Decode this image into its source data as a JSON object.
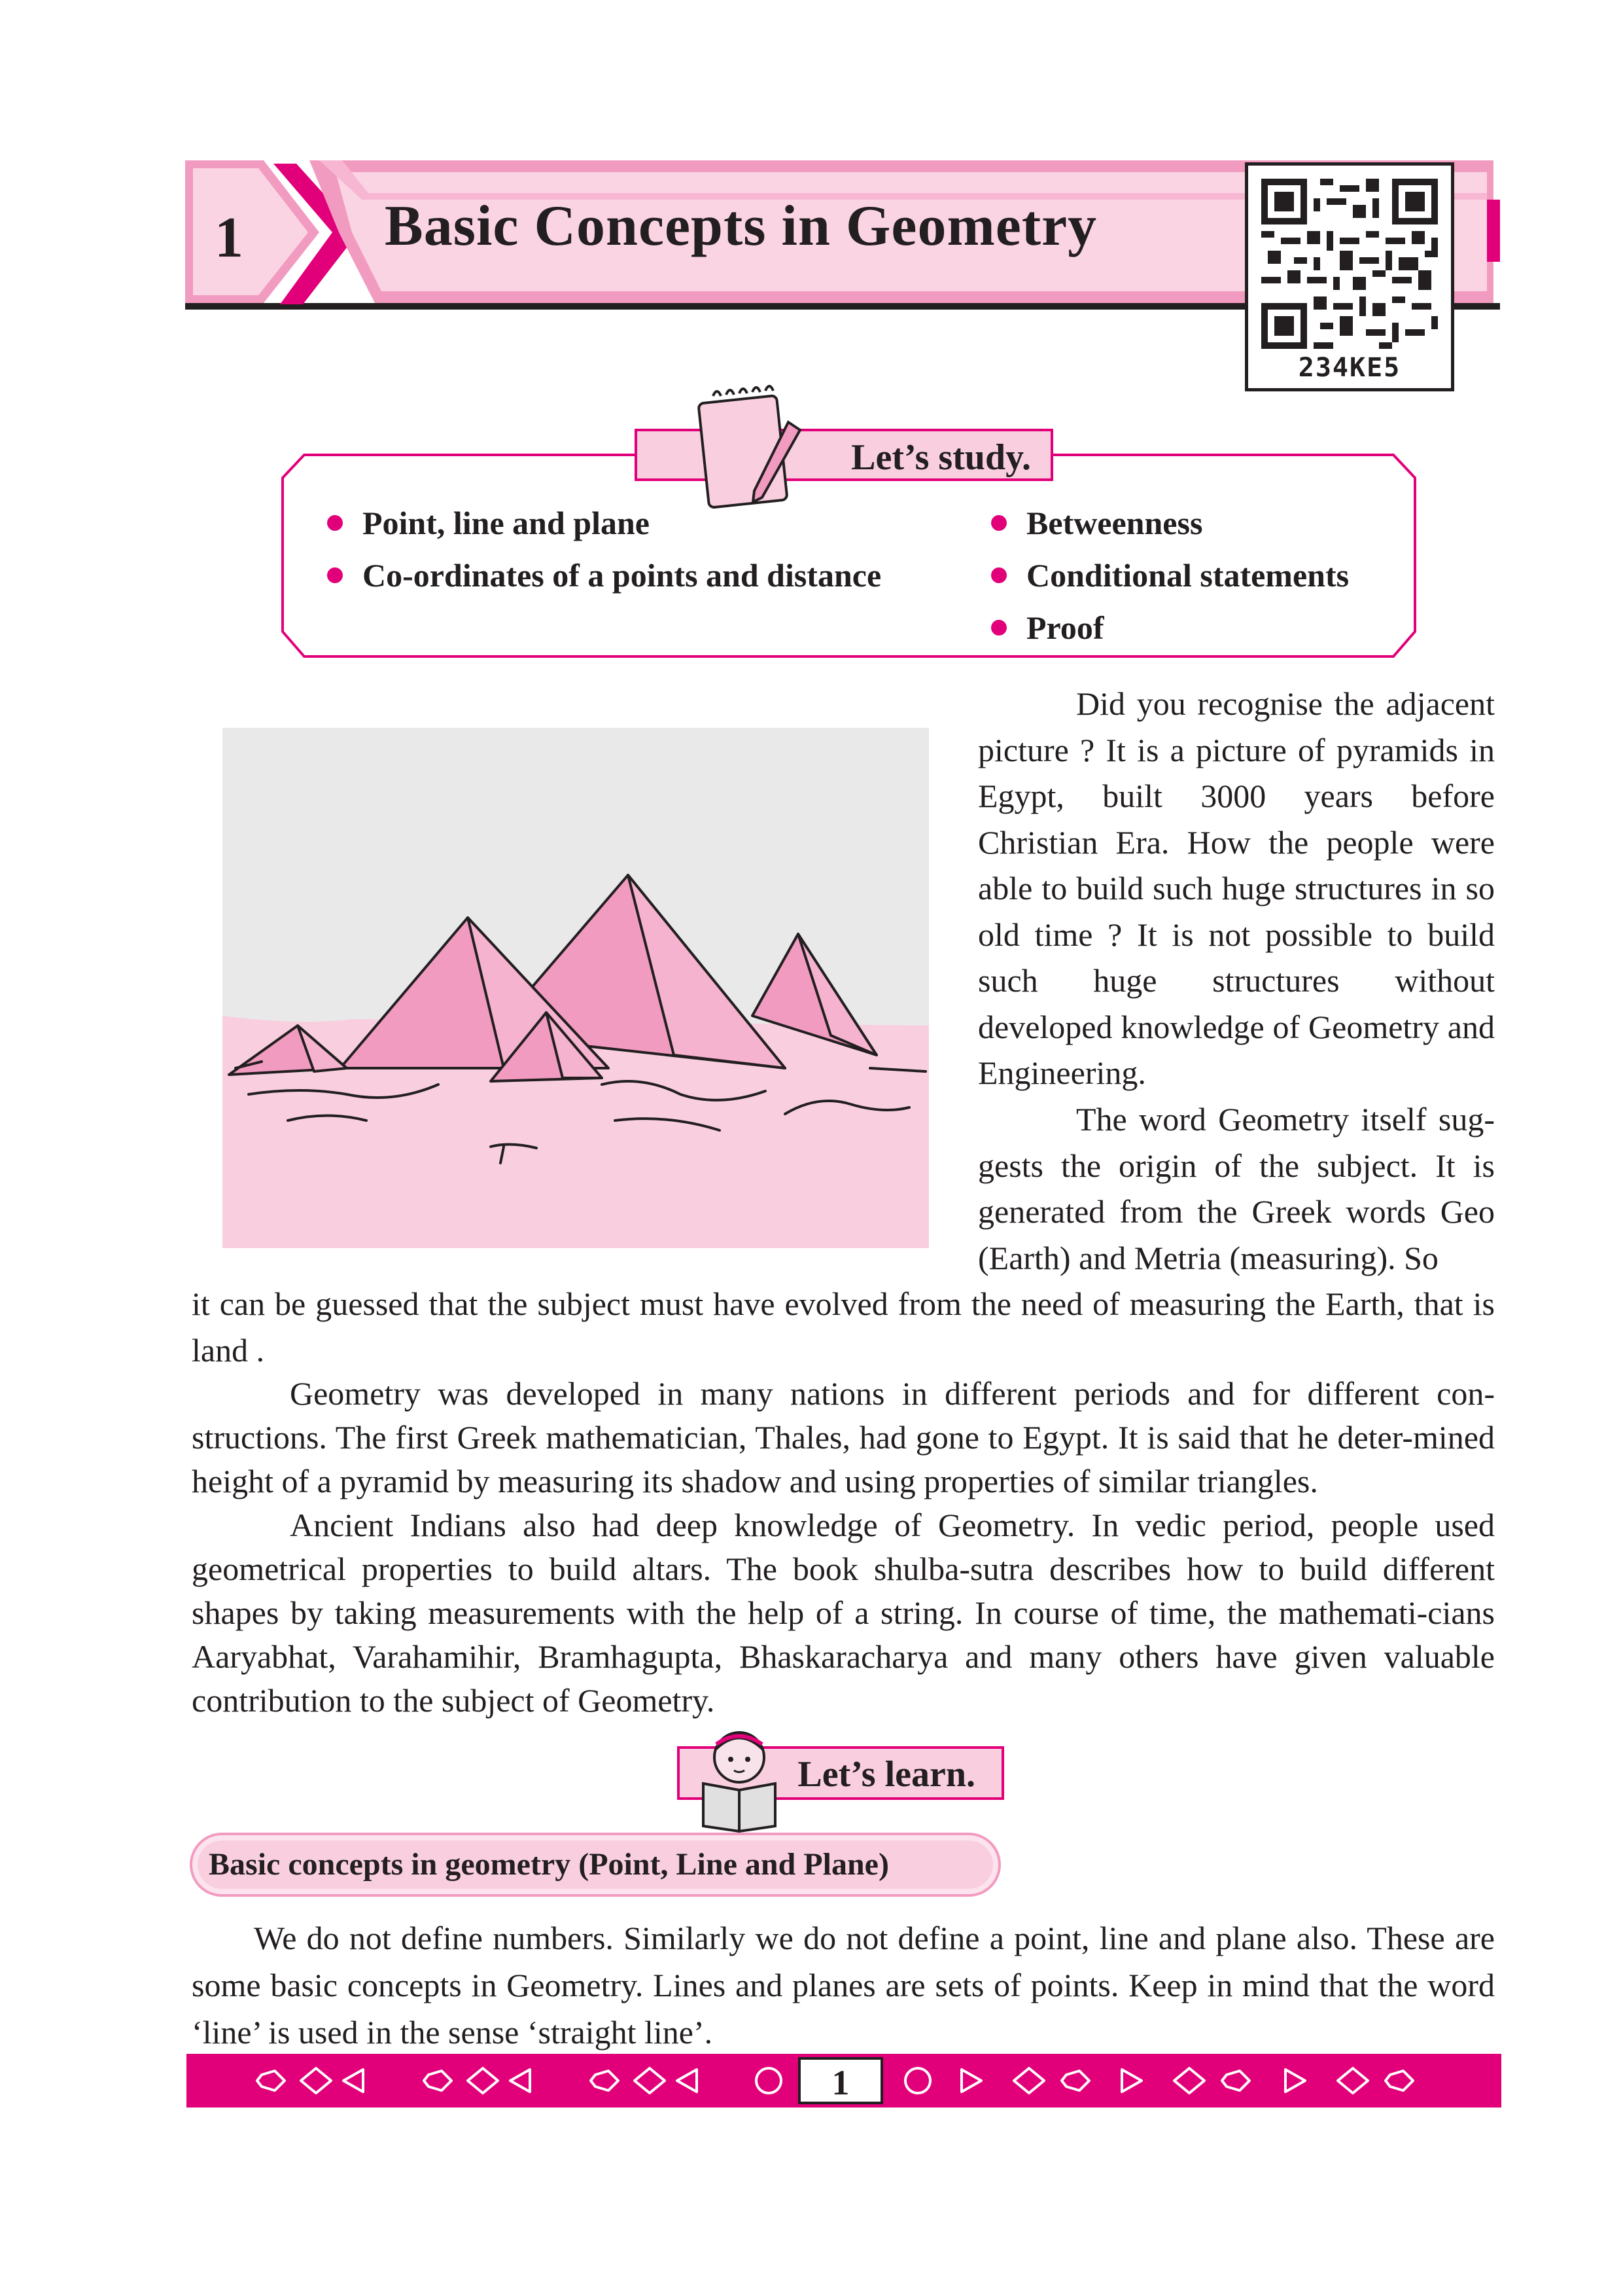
{
  "colors": {
    "accent": "#e2007a",
    "pink_light": "#f9cfe0",
    "pink_mid": "#f29bc1",
    "text": "#231f20"
  },
  "header": {
    "chapter_number": "1",
    "chapter_title": "Basic Concepts in Geometry",
    "qr_code_text": "234KE5"
  },
  "study": {
    "label": "Let’s study.",
    "icon": "notepad-pencil-icon",
    "left_items": [
      "Point, line  and  plane",
      "Co-ordinates of a points  and  distance"
    ],
    "right_items": [
      "Betweenness",
      "Conditional statements",
      "Proof"
    ]
  },
  "intro": {
    "picture_icon": "pyramids-illustration",
    "paragraphs_right": [
      "Did you recognise the adjacent picture ? It is a picture of pyramids in Egypt, built 3000 years before Christian Era. How the people were able to build such huge structures in so old time ? It is not possible to build such huge structures without developed knowledge of Geometry and  Engineering.",
      "The word Geometry itself sug-gests the origin of the subject. It is generated from the Greek words Geo (Earth)  and  Metria (measuring). So"
    ],
    "continuation": "it can be guessed that the subject must have evolved from the need of measuring the Earth, that is land ."
  },
  "body": {
    "paragraphs": [
      "Geometry was developed in many nations in different periods  and  for different con-structions. The first Greek mathematician, Thales, had gone to Egypt. It is said that he deter-mined height of a pyramid by measuring its shadow  and  using properties of similar triangles.",
      "Ancient Indians also had deep knowledge of Geometry. In vedic period, people used geometrical properties to build altars. The book shulba-sutra describes how to build different shapes by taking measurements with the help of a string. In course of time, the mathemati-cians Aaryabhat, Varahamihir, Bramhagupta, Bhaskaracharya and many others have given valuable contribution to the subject of Geometry."
    ]
  },
  "learn": {
    "label": "Let’s learn.",
    "icon": "girl-reading-icon"
  },
  "section": {
    "heading": "Basic concepts in geometry (Point, Line  and  Plane)",
    "paragraph": "We do not define numbers. Similarly we do not define a point, line  and  plane also. These are some basic concepts in Geometry. Lines  and  planes are sets of points. Keep in mind that the word ‘line’ is used in the sense ‘straight line’."
  },
  "footer": {
    "page_number": "1"
  }
}
